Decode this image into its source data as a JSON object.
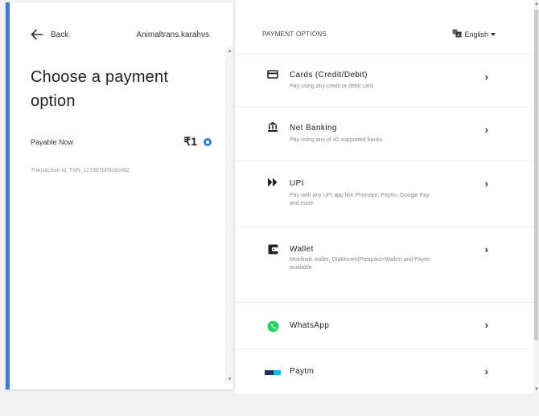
{
  "left": {
    "back_label": "Back",
    "merchant": "Animaltrans.karahvs",
    "title": "Choose a payment option",
    "payable_label": "Payable Now",
    "amount": "₹1",
    "transaction": "Transaction Id: TXN_c21907bf0fc6ce82"
  },
  "right": {
    "header_title": "PAYMENT OPTIONS",
    "language": "English",
    "options": [
      {
        "name": "Cards (Credit/Debit)",
        "desc": "Pay using any credit or debit card",
        "icon": "credit-card-icon"
      },
      {
        "name": "Net Banking",
        "desc": "Pay using any of 42 supported banks",
        "icon": "bank-icon"
      },
      {
        "name": "UPI",
        "desc": "Pay with any UPI app like Phonepe, Paytm, Google Pay and more",
        "icon": "upi-icon"
      },
      {
        "name": "Wallet",
        "desc": "Mobikwik wallet, OlaMoney(Postpaid+Wallet) and Paytm available",
        "icon": "wallet-icon"
      },
      {
        "name": "WhatsApp",
        "desc": "",
        "icon": "whatsapp-icon"
      },
      {
        "name": "Paytm",
        "desc": "",
        "icon": "paytm-icon"
      }
    ],
    "chevron": "›"
  },
  "colors": {
    "accent": "#3a7bd5",
    "whatsapp": "#25d366",
    "paytm_navy": "#20336b",
    "paytm_blue": "#00baf2"
  }
}
